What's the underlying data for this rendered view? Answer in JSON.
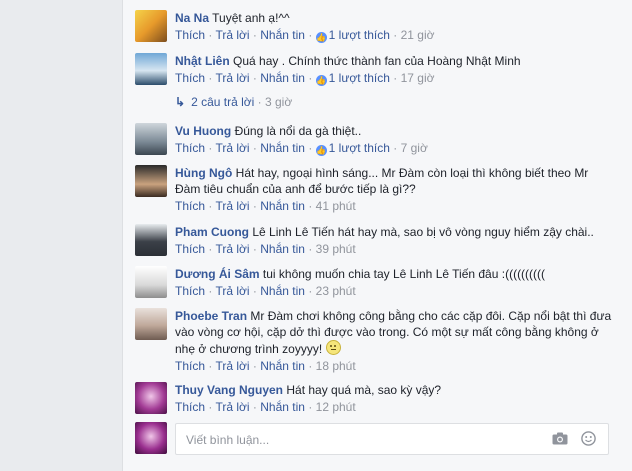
{
  "comments": [
    {
      "name": "Na Na",
      "text": "Tuyệt anh ạ!^^",
      "actions": {
        "like": "Thích",
        "reply": "Trả lời",
        "message": "Nhắn tin",
        "likes_count": "1 lượt thích",
        "time": "21 giờ"
      }
    },
    {
      "name": "Nhật Liên",
      "text": "Quá hay . Chính thức thành fan của Hoàng Nhật Minh",
      "actions": {
        "like": "Thích",
        "reply": "Trả lời",
        "message": "Nhắn tin",
        "likes_count": "1 lượt thích",
        "time": "17 giờ"
      },
      "replies": {
        "label": "2 câu trả lời",
        "time": "3 giờ"
      }
    },
    {
      "name": "Vu Huong",
      "text": "Đúng là nổi da gà thiệt..",
      "actions": {
        "like": "Thích",
        "reply": "Trả lời",
        "message": "Nhắn tin",
        "likes_count": "1 lượt thích",
        "time": "7 giờ"
      }
    },
    {
      "name": "Hùng Ngô",
      "text": "Hát hay, ngoại hình sáng... Mr Đàm còn loại thì không biết theo Mr Đàm tiêu chuẩn của anh để bước tiếp là gì??",
      "actions": {
        "like": "Thích",
        "reply": "Trả lời",
        "message": "Nhắn tin",
        "time": "41 phút"
      }
    },
    {
      "name": "Pham Cuong",
      "text": "Lê Linh Lê Tiến hát hay mà, sao bị vô vòng nguy hiểm zậy chài..",
      "actions": {
        "like": "Thích",
        "reply": "Trả lời",
        "message": "Nhắn tin",
        "time": "39 phút"
      }
    },
    {
      "name": "Dương Ái Sâm",
      "text": "tui không muốn chia tay Lê Linh Lê Tiến đâu :((((((((((",
      "actions": {
        "like": "Thích",
        "reply": "Trả lời",
        "message": "Nhắn tin",
        "time": "23 phút"
      }
    },
    {
      "name": "Phoebe Tran",
      "text": "Mr Đàm chơi không công bằng cho các cặp đôi. Cặp nổi bật thì đưa vào vòng cơ hội, cặp dở thì được vào trong. Có một sự mất công bằng không ở nhẹ ở chương trình zoyyyy!",
      "actions": {
        "like": "Thích",
        "reply": "Trả lời",
        "message": "Nhắn tin",
        "time": "18 phút"
      }
    },
    {
      "name": "Thuy Vang Nguyen",
      "text": "Hát hay quá mà, sao kỳ vậy?",
      "actions": {
        "like": "Thích",
        "reply": "Trả lời",
        "message": "Nhắn tin",
        "time": "12 phút"
      }
    }
  ],
  "compose": {
    "placeholder": "Viết bình luận..."
  },
  "colors": {
    "link": "#365899",
    "meta": "#90949c",
    "like_badge": "#5890ff"
  },
  "icons": [
    "like-icon",
    "reply-arrow-icon",
    "emoji-icon",
    "camera-icon",
    "smiley-icon"
  ]
}
